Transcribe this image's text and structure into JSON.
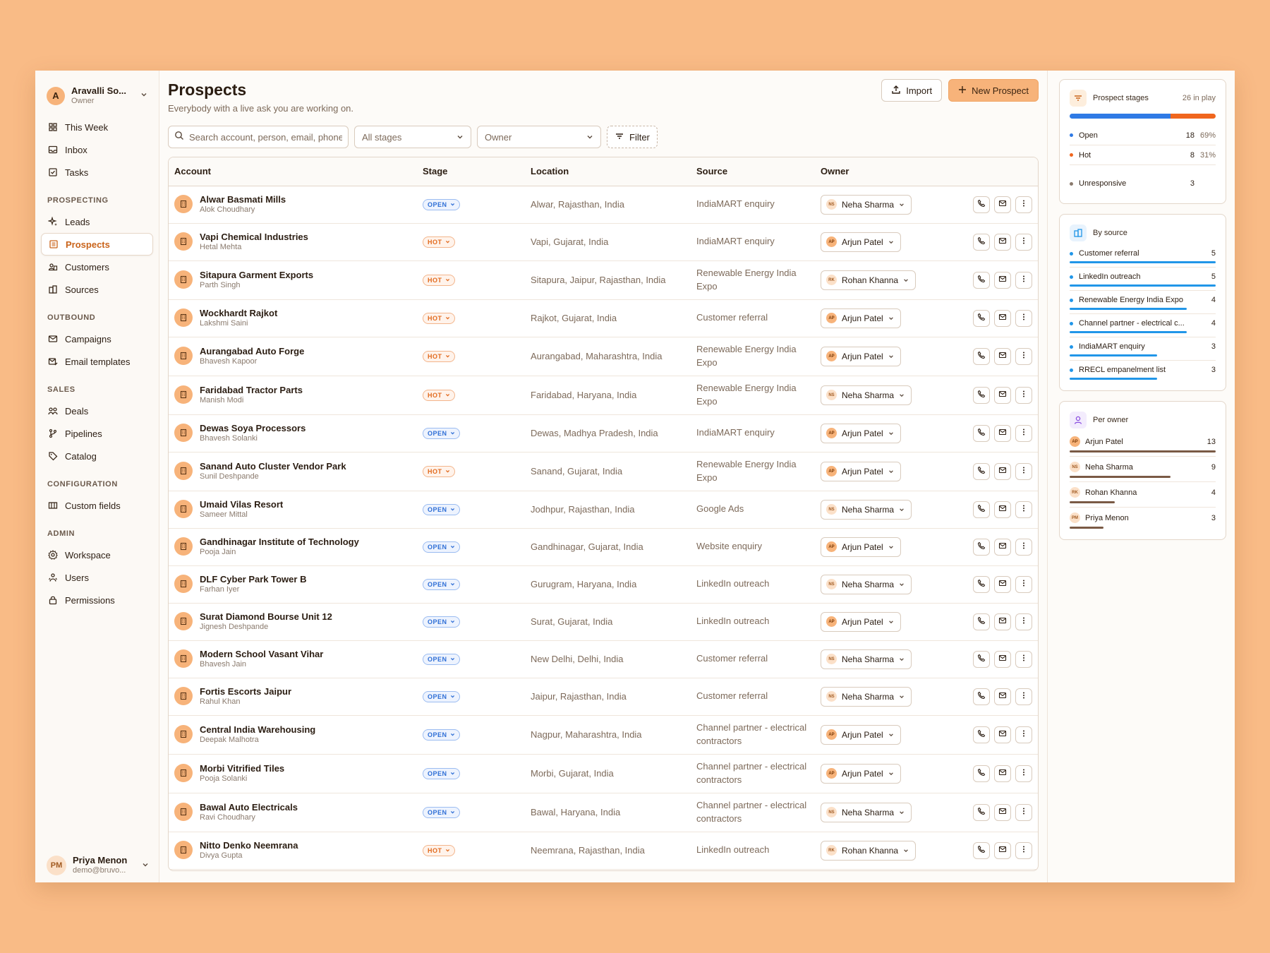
{
  "workspace": {
    "initial": "A",
    "name": "Aravalli So...",
    "role": "Owner"
  },
  "nav": {
    "top": [
      {
        "label": "This Week",
        "icon": "grid-icon"
      },
      {
        "label": "Inbox",
        "icon": "inbox-icon"
      },
      {
        "label": "Tasks",
        "icon": "checkbox-icon"
      }
    ],
    "sections": [
      {
        "title": "PROSPECTING",
        "items": [
          {
            "label": "Leads",
            "icon": "sparkle-icon",
            "active": false
          },
          {
            "label": "Prospects",
            "icon": "list-icon",
            "active": true
          },
          {
            "label": "Customers",
            "icon": "users-icon",
            "active": false
          },
          {
            "label": "Sources",
            "icon": "building-icon",
            "active": false
          }
        ]
      },
      {
        "title": "OUTBOUND",
        "items": [
          {
            "label": "Campaigns",
            "icon": "mail-icon",
            "active": false
          },
          {
            "label": "Email templates",
            "icon": "mail-edit-icon",
            "active": false
          }
        ]
      },
      {
        "title": "SALES",
        "items": [
          {
            "label": "Deals",
            "icon": "deals-icon",
            "active": false
          },
          {
            "label": "Pipelines",
            "icon": "branch-icon",
            "active": false
          },
          {
            "label": "Catalog",
            "icon": "tag-icon",
            "active": false
          }
        ]
      },
      {
        "title": "CONFIGURATION",
        "items": [
          {
            "label": "Custom fields",
            "icon": "fields-icon",
            "active": false
          }
        ]
      },
      {
        "title": "ADMIN",
        "items": [
          {
            "label": "Workspace",
            "icon": "gear-icon",
            "active": false
          },
          {
            "label": "Users",
            "icon": "team-icon",
            "active": false
          },
          {
            "label": "Permissions",
            "icon": "lock-icon",
            "active": false
          }
        ]
      }
    ]
  },
  "user": {
    "initials": "PM",
    "name": "Priya Menon",
    "email": "demo@bruvo..."
  },
  "page": {
    "title": "Prospects",
    "subtitle": "Everybody with a live ask you are working on."
  },
  "buttons": {
    "import": "Import",
    "new_prospect": "New Prospect",
    "filter": "Filter"
  },
  "search": {
    "placeholder": "Search account, person, email, phone"
  },
  "filters": {
    "stage": "All stages",
    "owner": "Owner"
  },
  "columns": [
    "Account",
    "Stage",
    "Location",
    "Source",
    "Owner"
  ],
  "rows": [
    {
      "account": "Alwar Basmati Mills",
      "person": "Alok Choudhary",
      "stage": "OPEN",
      "location": "Alwar, Rajasthan, India",
      "source": "IndiaMART enquiry",
      "owner": "Neha Sharma",
      "owner_initials": "NS"
    },
    {
      "account": "Vapi Chemical Industries",
      "person": "Hetal Mehta",
      "stage": "HOT",
      "location": "Vapi, Gujarat, India",
      "source": "IndiaMART enquiry",
      "owner": "Arjun Patel",
      "owner_initials": "AP"
    },
    {
      "account": "Sitapura Garment Exports",
      "person": "Parth Singh",
      "stage": "HOT",
      "location": "Sitapura, Jaipur, Rajasthan, India",
      "source": "Renewable Energy India Expo",
      "owner": "Rohan Khanna",
      "owner_initials": "RK"
    },
    {
      "account": "Wockhardt Rajkot",
      "person": "Lakshmi Saini",
      "stage": "HOT",
      "location": "Rajkot, Gujarat, India",
      "source": "Customer referral",
      "owner": "Arjun Patel",
      "owner_initials": "AP"
    },
    {
      "account": "Aurangabad Auto Forge",
      "person": "Bhavesh Kapoor",
      "stage": "HOT",
      "location": "Aurangabad, Maharashtra, India",
      "source": "Renewable Energy India Expo",
      "owner": "Arjun Patel",
      "owner_initials": "AP"
    },
    {
      "account": "Faridabad Tractor Parts",
      "person": "Manish Modi",
      "stage": "HOT",
      "location": "Faridabad, Haryana, India",
      "source": "Renewable Energy India Expo",
      "owner": "Neha Sharma",
      "owner_initials": "NS"
    },
    {
      "account": "Dewas Soya Processors",
      "person": "Bhavesh Solanki",
      "stage": "OPEN",
      "location": "Dewas, Madhya Pradesh, India",
      "source": "IndiaMART enquiry",
      "owner": "Arjun Patel",
      "owner_initials": "AP"
    },
    {
      "account": "Sanand Auto Cluster Vendor Park",
      "person": "Sunil Deshpande",
      "stage": "HOT",
      "location": "Sanand, Gujarat, India",
      "source": "Renewable Energy India Expo",
      "owner": "Arjun Patel",
      "owner_initials": "AP"
    },
    {
      "account": "Umaid Vilas Resort",
      "person": "Sameer Mittal",
      "stage": "OPEN",
      "location": "Jodhpur, Rajasthan, India",
      "source": "Google Ads",
      "owner": "Neha Sharma",
      "owner_initials": "NS"
    },
    {
      "account": "Gandhinagar Institute of Technology",
      "person": "Pooja Jain",
      "stage": "OPEN",
      "location": "Gandhinagar, Gujarat, India",
      "source": "Website enquiry",
      "owner": "Arjun Patel",
      "owner_initials": "AP"
    },
    {
      "account": "DLF Cyber Park Tower B",
      "person": "Farhan Iyer",
      "stage": "OPEN",
      "location": "Gurugram, Haryana, India",
      "source": "LinkedIn outreach",
      "owner": "Neha Sharma",
      "owner_initials": "NS"
    },
    {
      "account": "Surat Diamond Bourse Unit 12",
      "person": "Jignesh Deshpande",
      "stage": "OPEN",
      "location": "Surat, Gujarat, India",
      "source": "LinkedIn outreach",
      "owner": "Arjun Patel",
      "owner_initials": "AP"
    },
    {
      "account": "Modern School Vasant Vihar",
      "person": "Bhavesh Jain",
      "stage": "OPEN",
      "location": "New Delhi, Delhi, India",
      "source": "Customer referral",
      "owner": "Neha Sharma",
      "owner_initials": "NS"
    },
    {
      "account": "Fortis Escorts Jaipur",
      "person": "Rahul Khan",
      "stage": "OPEN",
      "location": "Jaipur, Rajasthan, India",
      "source": "Customer referral",
      "owner": "Neha Sharma",
      "owner_initials": "NS"
    },
    {
      "account": "Central India Warehousing",
      "person": "Deepak Malhotra",
      "stage": "OPEN",
      "location": "Nagpur, Maharashtra, India",
      "source": "Channel partner - electrical contractors",
      "owner": "Arjun Patel",
      "owner_initials": "AP"
    },
    {
      "account": "Morbi Vitrified Tiles",
      "person": "Pooja Solanki",
      "stage": "OPEN",
      "location": "Morbi, Gujarat, India",
      "source": "Channel partner - electrical contractors",
      "owner": "Arjun Patel",
      "owner_initials": "AP"
    },
    {
      "account": "Bawal Auto Electricals",
      "person": "Ravi Choudhary",
      "stage": "OPEN",
      "location": "Bawal, Haryana, India",
      "source": "Channel partner - electrical contractors",
      "owner": "Neha Sharma",
      "owner_initials": "NS"
    },
    {
      "account": "Nitto Denko Neemrana",
      "person": "Divya Gupta",
      "stage": "HOT",
      "location": "Neemrana, Rajasthan, India",
      "source": "LinkedIn outreach",
      "owner": "Rohan Khanna",
      "owner_initials": "RK"
    }
  ],
  "stages_card": {
    "title": "Prospect stages",
    "meta": "26 in play",
    "items": [
      {
        "label": "Open",
        "count": "18",
        "pct": "69%",
        "fraction": 0.69,
        "color": "#2f7ae5"
      },
      {
        "label": "Hot",
        "count": "8",
        "pct": "31%",
        "fraction": 0.31,
        "color": "#f0661e"
      },
      {
        "label": "Unresponsive",
        "count": "3",
        "pct": "",
        "fraction": 0,
        "color": "#8a7a6d"
      }
    ]
  },
  "source_card": {
    "title": "By source",
    "color": "#2196e8",
    "items": [
      {
        "label": "Customer referral",
        "count": "5",
        "fraction": 1.0
      },
      {
        "label": "LinkedIn outreach",
        "count": "5",
        "fraction": 1.0
      },
      {
        "label": "Renewable Energy India Expo",
        "count": "4",
        "fraction": 0.8
      },
      {
        "label": "Channel partner - electrical c...",
        "count": "4",
        "fraction": 0.8
      },
      {
        "label": "IndiaMART enquiry",
        "count": "3",
        "fraction": 0.6
      },
      {
        "label": "RRECL empanelment list",
        "count": "3",
        "fraction": 0.6
      }
    ]
  },
  "owner_card": {
    "title": "Per owner",
    "color": "#7a5a45",
    "items": [
      {
        "label": "Arjun Patel",
        "initials": "AP",
        "count": "13",
        "fraction": 1.0
      },
      {
        "label": "Neha Sharma",
        "initials": "NS",
        "count": "9",
        "fraction": 0.69
      },
      {
        "label": "Rohan Khanna",
        "initials": "RK",
        "count": "4",
        "fraction": 0.31
      },
      {
        "label": "Priya Menon",
        "initials": "PM",
        "count": "3",
        "fraction": 0.23
      }
    ]
  }
}
